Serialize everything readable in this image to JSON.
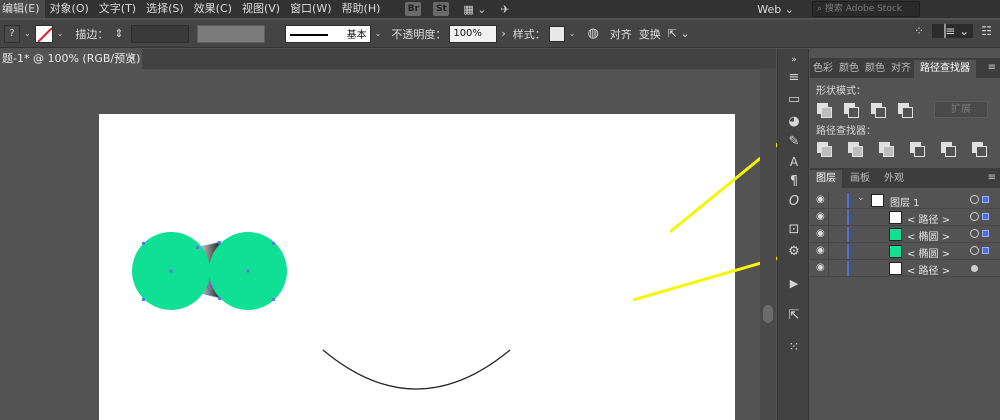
{
  "menu": {
    "items": [
      "编辑(E)",
      "对象(O)",
      "文字(T)",
      "选择(S)",
      "效果(C)",
      "视图(V)",
      "窗口(W)",
      "帮助(H)"
    ],
    "bridge_labels": [
      "Br",
      "St"
    ],
    "workspace": "Web",
    "stock_search_placeholder": "搜索 Adobe Stock"
  },
  "control": {
    "stroke_label": "描边：",
    "stroke_profile": "基本",
    "opacity_label": "不透明度：",
    "opacity_value": "100%",
    "style_label": "样式：",
    "align_label": "对齐",
    "transform_label": "变换"
  },
  "document": {
    "tab_label": "题-1* @ 100% (RGB/预览)",
    "close_glyph": "×"
  },
  "pathfinder_panel": {
    "tabs": [
      "色彩",
      "颜色",
      "颜色",
      "对齐",
      "路径查找器"
    ],
    "shape_modes_label": "形状模式：",
    "expand_label": "扩展",
    "pathfinders_label": "路径查找器："
  },
  "layers_panel": {
    "tabs": [
      "图层",
      "画板",
      "外观"
    ],
    "rows": [
      {
        "name": "图层 1",
        "kind": "layer"
      },
      {
        "name": "< 路径 >",
        "kind": "path"
      },
      {
        "name": "< 椭圆 >",
        "kind": "ellipse"
      },
      {
        "name": "< 椭圆 >",
        "kind": "ellipse"
      },
      {
        "name": "< 路径 >",
        "kind": "path"
      }
    ]
  },
  "colors": {
    "ellipse_fill": "#10df96",
    "accent": "#4c6edc",
    "annotation_arrow": "#f5f50a"
  }
}
